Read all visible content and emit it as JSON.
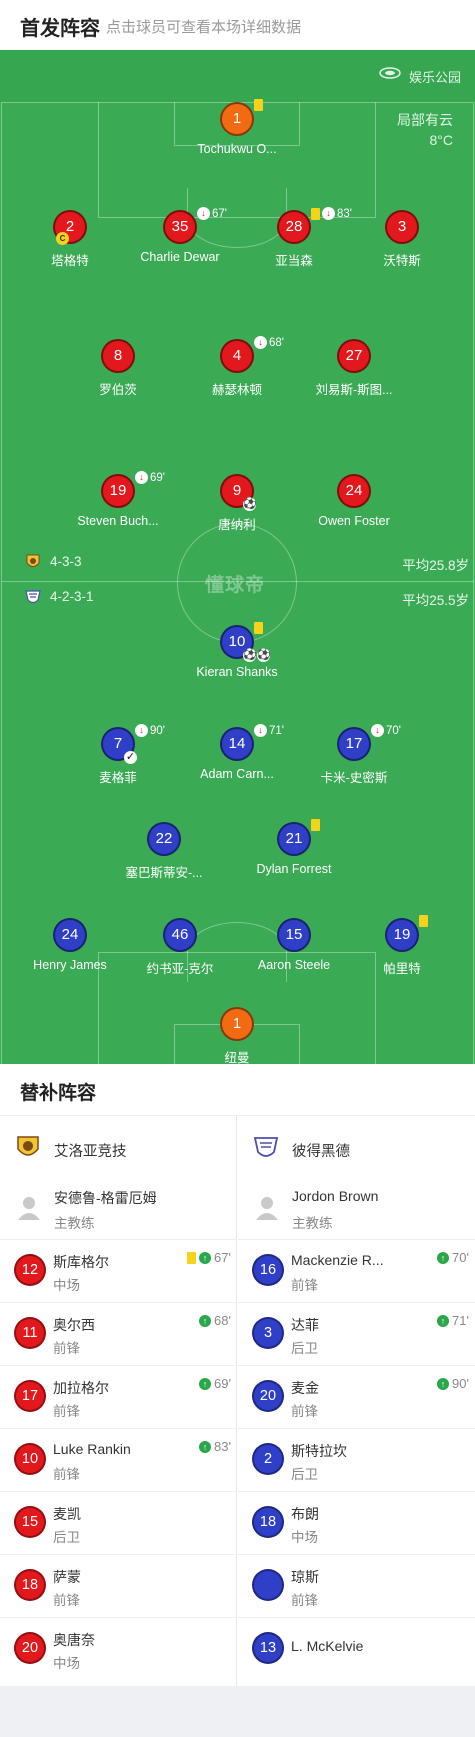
{
  "header": {
    "title": "首发阵容",
    "subtitle": "点击球员可查看本场详细数据"
  },
  "pitch": {
    "venue": "娱乐公园",
    "weather": "局部有云",
    "temperature": "8°C",
    "watermark": "懂球帝",
    "home_form": "4-3-3",
    "home_avg_age": "平均25.8岁",
    "away_form": "4-2-3-1",
    "away_avg_age": "平均25.5岁"
  },
  "home_players": [
    {
      "num": "1",
      "name": "Tochukwu O...",
      "color": "orange",
      "yellow": true
    },
    {
      "num": "2",
      "name": "塔格特",
      "color": "red",
      "captain": "C"
    },
    {
      "num": "35",
      "name": "Charlie Dewar",
      "color": "red",
      "sub_out": "67'"
    },
    {
      "num": "28",
      "name": "亚当森",
      "color": "red",
      "yellow": true,
      "sub_out": "83'"
    },
    {
      "num": "3",
      "name": "沃特斯",
      "color": "red"
    },
    {
      "num": "8",
      "name": "罗伯茨",
      "color": "red"
    },
    {
      "num": "4",
      "name": "赫瑟林顿",
      "color": "red",
      "sub_out": "68'"
    },
    {
      "num": "27",
      "name": "刘易斯-斯图...",
      "color": "red"
    },
    {
      "num": "19",
      "name": "Steven Buch...",
      "color": "red",
      "sub_out": "69'"
    },
    {
      "num": "9",
      "name": "唐纳利",
      "color": "red",
      "goals": 1
    },
    {
      "num": "24",
      "name": "Owen Foster",
      "color": "red"
    }
  ],
  "away_players": [
    {
      "num": "10",
      "name": "Kieran Shanks",
      "color": "blue",
      "yellow": true,
      "goals": 2
    },
    {
      "num": "7",
      "name": "麦格菲",
      "color": "blue",
      "sub_out": "90'",
      "assist": true
    },
    {
      "num": "14",
      "name": "Adam Carn...",
      "color": "blue",
      "sub_out": "71'"
    },
    {
      "num": "17",
      "name": "卡米-史密斯",
      "color": "blue",
      "sub_out": "70'"
    },
    {
      "num": "22",
      "name": "塞巴斯蒂安-...",
      "color": "blue"
    },
    {
      "num": "21",
      "name": "Dylan Forrest",
      "color": "blue",
      "yellow": true
    },
    {
      "num": "24",
      "name": "Henry James",
      "color": "blue"
    },
    {
      "num": "46",
      "name": "约书亚-克尔",
      "color": "blue"
    },
    {
      "num": "15",
      "name": "Aaron Steele",
      "color": "blue"
    },
    {
      "num": "19",
      "name": "帕里特",
      "color": "blue",
      "yellow": true
    },
    {
      "num": "1",
      "name": "纽曼",
      "color": "orange"
    }
  ],
  "subs": {
    "title": "替补阵容",
    "home": {
      "team": "艾洛亚竞技",
      "coach": "安德鲁-格雷厄姆",
      "coach_role": "主教练",
      "players": [
        {
          "num": "12",
          "name": "斯库格尔",
          "pos": "中场",
          "yellow": true,
          "sub_in": "67'"
        },
        {
          "num": "11",
          "name": "奥尔西",
          "pos": "前锋",
          "sub_in": "68'"
        },
        {
          "num": "17",
          "name": "加拉格尔",
          "pos": "前锋",
          "sub_in": "69'"
        },
        {
          "num": "10",
          "name": "Luke Rankin",
          "pos": "前锋",
          "sub_in": "83'"
        },
        {
          "num": "15",
          "name": "麦凯",
          "pos": "后卫"
        },
        {
          "num": "18",
          "name": "萨蒙",
          "pos": "前锋"
        },
        {
          "num": "20",
          "name": "奥唐奈",
          "pos": "中场"
        }
      ]
    },
    "away": {
      "team": "彼得黑德",
      "coach": "Jordon Brown",
      "coach_role": "主教练",
      "players": [
        {
          "num": "16",
          "name": "Mackenzie R...",
          "pos": "前锋",
          "sub_in": "70'"
        },
        {
          "num": "3",
          "name": "达菲",
          "pos": "后卫",
          "sub_in": "71'"
        },
        {
          "num": "20",
          "name": "麦金",
          "pos": "前锋",
          "sub_in": "90'"
        },
        {
          "num": "2",
          "name": "斯特拉坎",
          "pos": "后卫"
        },
        {
          "num": "18",
          "name": "布朗",
          "pos": "中场"
        },
        {
          "num": "",
          "name": "琼斯",
          "pos": "前锋"
        },
        {
          "num": "13",
          "name": "L. McKelvie",
          "pos": ""
        }
      ]
    }
  }
}
